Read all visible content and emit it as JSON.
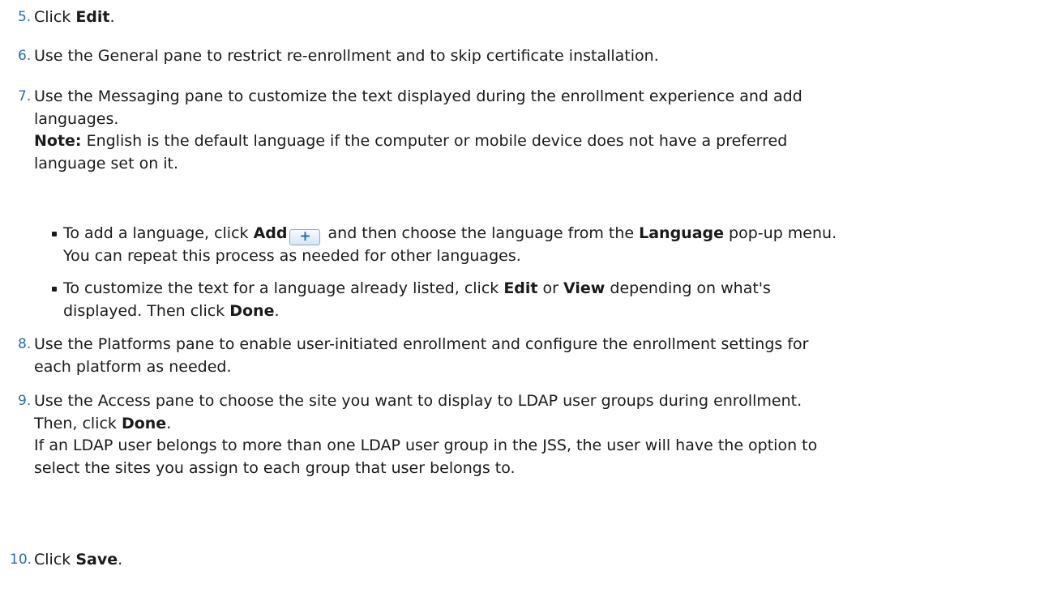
{
  "steps": [
    {
      "num": "5.",
      "pre": "Click ",
      "b1": "Edit",
      "post": "."
    },
    {
      "num": "6.",
      "text": "Use the General pane to restrict re-enrollment and to skip certificate installation."
    },
    {
      "num": "7.",
      "line1": "Use the Messaging pane to customize the text displayed during the enrollment experience and add",
      "line2": "languages.",
      "note_label": "Note:",
      "note_text": " English is the default language if the computer or mobile device does not have a preferred",
      "note_text2": "language set on it."
    },
    {
      "num": "8.",
      "line1": "Use the Platforms pane to enable user-initiated enrollment and configure the enrollment settings for",
      "line2": "each platform as needed."
    },
    {
      "num": "9.",
      "line1": "Use the Access pane to choose the site you want to display to LDAP user groups during enrollment.",
      "line2_pre": "Then, click ",
      "line2_b": "Done",
      "line2_post": ".",
      "line3": "If an LDAP user belongs to more than one LDAP user group in the JSS, the user will have the option to",
      "line4": "select the sites you assign to each group that user belongs to."
    },
    {
      "num": "10.",
      "pre": "Click ",
      "b1": "Save",
      "post": "."
    }
  ],
  "bullets": [
    {
      "pre": "To add a language, click ",
      "b1": "Add",
      "icon": "+",
      "mid": " and then choose the language from the ",
      "b2": "Language",
      "post": " pop-up menu.",
      "line2": "You can repeat this process as needed for other languages."
    },
    {
      "pre": "To customize the text for a language already listed, click ",
      "b1": "Edit",
      "mid": " or ",
      "b2": "View",
      "post": " depending on what's",
      "line2_pre": "displayed. Then click ",
      "line2_b": "Done",
      "line2_post": "."
    }
  ]
}
